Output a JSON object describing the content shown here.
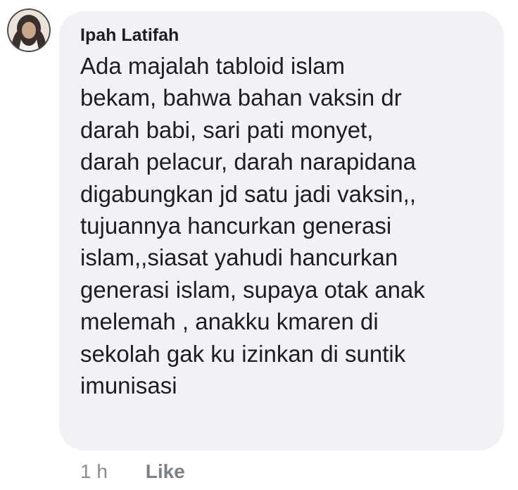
{
  "comment": {
    "author": "Ipah Latifah",
    "lines": [
      "Ada majalah tabloid islam",
      "bekam, bahwa bahan vaksin dr",
      "darah babi, sari pati monyet,",
      "darah pelacur, darah narapidana",
      "digabungkan jd satu jadi vaksin,,",
      "tujuannya hancurkan generasi",
      "islam,,siasat yahudi hancurkan",
      "generasi islam, supaya otak anak",
      "melemah , anakku kmaren di",
      "sekolah gak ku izinkan di suntik",
      "imunisasi"
    ]
  },
  "actions": {
    "time": "1 h",
    "like": "Like"
  },
  "avatar": {
    "icon": "user-avatar-hijab",
    "colors": {
      "background": "#e9e3dc",
      "face": "#caa68a",
      "hijab": "#3a2f2c",
      "border": "#4a4a4a"
    }
  },
  "colors": {
    "bubble": "#f1f2f6",
    "text": "#1c1e21",
    "meta": "#8a8d91"
  }
}
